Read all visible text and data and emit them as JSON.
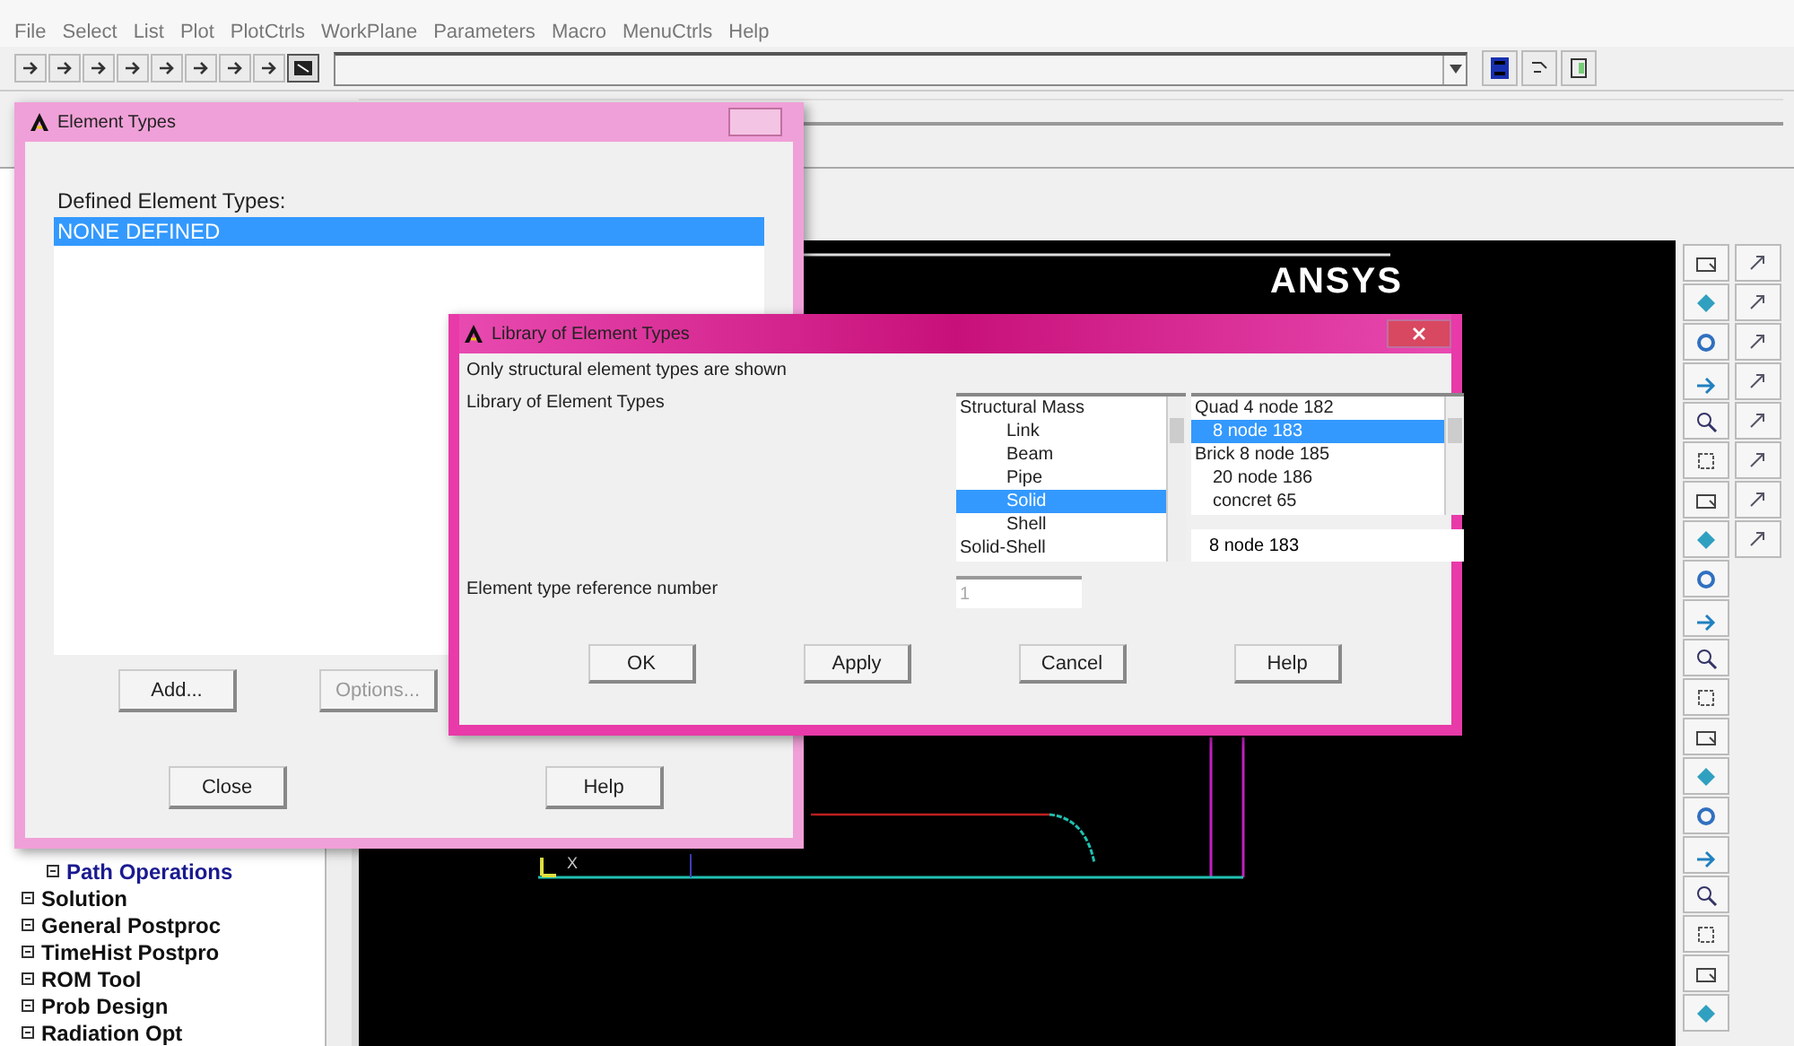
{
  "menu_bar": [
    {
      "label": "File"
    },
    {
      "label": "Select"
    },
    {
      "label": "List"
    },
    {
      "label": "Plot"
    },
    {
      "label": "PlotCtrls"
    },
    {
      "label": "WorkPlane"
    },
    {
      "label": "Parameters"
    },
    {
      "label": "Macro"
    },
    {
      "label": "MenuCtrls"
    },
    {
      "label": "Help"
    }
  ],
  "main_menu_tree": [
    {
      "label": "Path Operations",
      "kind": "sub"
    },
    {
      "label": "Solution",
      "kind": "top"
    },
    {
      "label": "General Postproc",
      "kind": "top"
    },
    {
      "label": "TimeHist Postpro",
      "kind": "top"
    },
    {
      "label": "ROM Tool",
      "kind": "top"
    },
    {
      "label": "Prob Design",
      "kind": "top"
    },
    {
      "label": "Radiation Opt",
      "kind": "top"
    }
  ],
  "graphics": {
    "logo": "ANSYS",
    "triad_label": "X"
  },
  "element_types_dialog": {
    "title": "Element Types",
    "heading": "Defined Element Types:",
    "items": [
      {
        "label": "NONE DEFINED",
        "selected": true
      }
    ],
    "buttons": [
      {
        "label": "Add...",
        "disabled": false
      },
      {
        "label": "Options...",
        "disabled": true
      },
      {
        "label": "Close",
        "disabled": false
      },
      {
        "label": "Help",
        "disabled": false
      }
    ]
  },
  "library_dialog": {
    "title": "Library of Element Types",
    "note": "Only structural element types are shown",
    "library_label": "Library of Element Types",
    "categories": [
      {
        "label": "Structural Mass",
        "selected": false,
        "children": [
          {
            "label": "Link",
            "selected": false
          },
          {
            "label": "Beam",
            "selected": false
          },
          {
            "label": "Pipe",
            "selected": false
          },
          {
            "label": "Solid",
            "selected": true
          },
          {
            "label": "Shell",
            "selected": false
          }
        ]
      },
      {
        "label": "Solid-Shell",
        "selected": false
      }
    ],
    "element_types": [
      {
        "label": "Quad 4 node 182",
        "selected": false,
        "children": [
          {
            "label": "8 node 183",
            "selected": true
          }
        ]
      },
      {
        "label": "Brick 8 node 185",
        "selected": false,
        "children": [
          {
            "label": "20 node 186",
            "selected": false
          },
          {
            "label": "concret 65",
            "selected": false
          }
        ]
      }
    ],
    "chosen_value": "8 node 183",
    "reference_label": "Element type reference number",
    "reference_value": "1",
    "buttons": [
      {
        "label": "OK"
      },
      {
        "label": "Apply"
      },
      {
        "label": "Cancel"
      },
      {
        "label": "Help"
      }
    ]
  }
}
